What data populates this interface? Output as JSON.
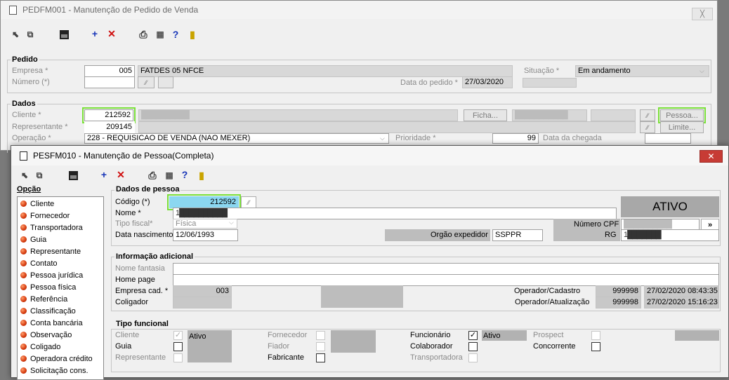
{
  "back": {
    "title": "PEDFM001 - Manutenção de Pedido de Venda",
    "close": "╳",
    "pedido": {
      "title": "Pedido",
      "empresa_label": "Empresa *",
      "empresa_code": "005",
      "empresa_name": "FATDES 05 NFCE",
      "numero_label": "Número (*)",
      "situacao_label": "Situação *",
      "situacao_value": "Em andamento",
      "data_label": "Data do pedido *",
      "data_value": "27/03/2020"
    },
    "dados": {
      "title": "Dados",
      "cliente_label": "Cliente *",
      "cliente_code": "212592",
      "cliente_name": "██████████",
      "ficha_btn": "Ficha...",
      "cliente_doc": "███████████",
      "pessoa_btn": "Pessoa...",
      "representante_label": "Representante *",
      "representante_code": "209145",
      "limite_btn": "Limite...",
      "operacao_label": "Operação *",
      "operacao_value": "228 - REQUISICAO DE VENDA (NAO MEXER)",
      "prioridade_label": "Prioridade *",
      "prioridade_value": "99",
      "chegada_label": "Data da chegada"
    }
  },
  "front": {
    "title": "PESFM010 - Manutenção de Pessoa(Completa)",
    "close": "✕",
    "opcao_title": "Opção",
    "options": [
      "Cliente",
      "Fornecedor",
      "Transportadora",
      "Guia",
      "Representante",
      "Contato",
      "Pessoa jurídica",
      "Pessoa física",
      "Referência",
      "Classificação",
      "Conta bancária",
      "Observação",
      "Coligado",
      "Operadora crédito",
      "Solicitação cons."
    ],
    "dados": {
      "title": "Dados de pessoa",
      "codigo_label": "Código (*)",
      "codigo_value": "212592",
      "nome_label": "Nome *",
      "nome_value": "1██████████",
      "tipo_label": "Tipo fiscal*",
      "tipo_value": "Física",
      "nasc_label": "Data nascimento",
      "nasc_value": "12/06/1993",
      "orgao_label": "Orgão expedidor",
      "orgao_value": "SSPPR",
      "status": "ATIVO",
      "cpf_label": "Número CPF",
      "cpf_value": "██████████",
      "cpf_btn": "»",
      "rg_label": "RG",
      "rg_value": "1███████"
    },
    "info": {
      "title": "Informação adicional",
      "fantasia_label": "Nome fantasia",
      "home_label": "Home page",
      "empresa_label": "Empresa cad. *",
      "empresa_value": "003",
      "coligador_label": "Coligador",
      "op_cad_label": "Operador/Cadastro",
      "op_cad_id": "999998",
      "op_cad_dt": "27/02/2020 08:43:35",
      "op_atu_label": "Operador/Atualização",
      "op_atu_id": "999998",
      "op_atu_dt": "27/02/2020 15:16:23"
    },
    "tipo": {
      "title": "Tipo funcional",
      "cliente": "Cliente",
      "ativo1": "Ativo",
      "guia": "Guia",
      "representante": "Representante",
      "fornecedor": "Fornecedor",
      "fiador": "Fiador",
      "fabricante": "Fabricante",
      "funcionario": "Funcionário",
      "ativo2": "Ativo",
      "colaborador": "Colaborador",
      "transportadora": "Transportadora",
      "prospect": "Prospect",
      "concorrente": "Concorrente"
    }
  }
}
